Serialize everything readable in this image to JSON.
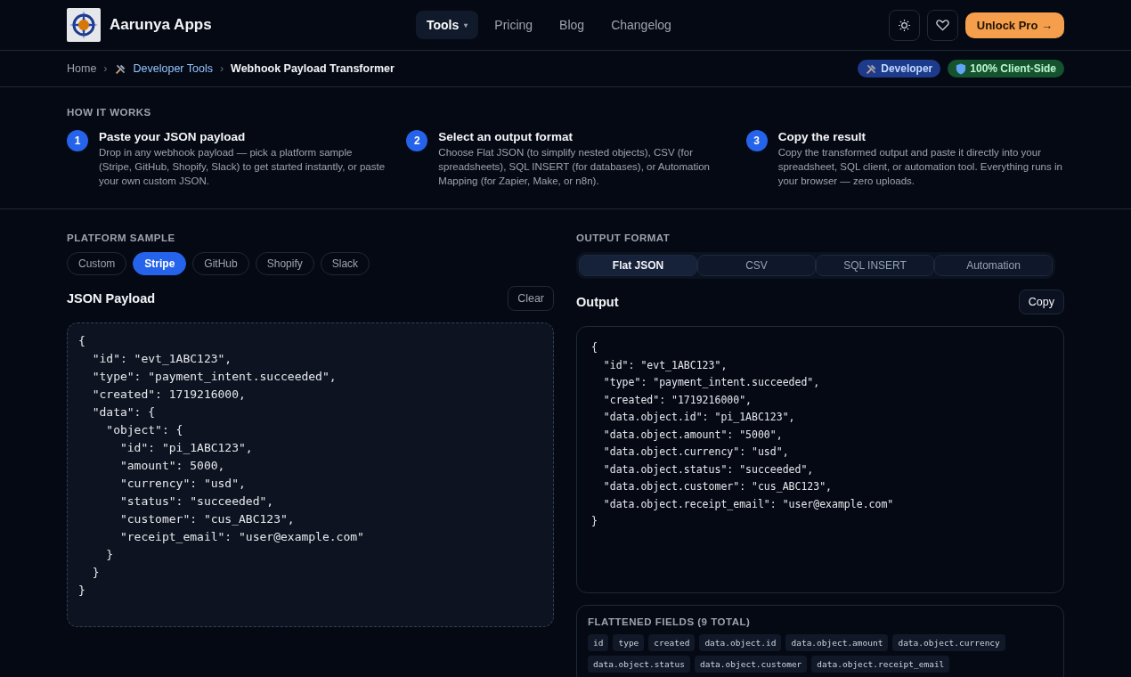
{
  "brand": {
    "name": "Aarunya Apps"
  },
  "nav": [
    {
      "label": "Tools",
      "selected": true,
      "caret": "▾"
    },
    {
      "label": "Pricing",
      "selected": false
    },
    {
      "label": "Blog",
      "selected": false
    },
    {
      "label": "Changelog",
      "selected": false
    }
  ],
  "cta": "Unlock Pro →",
  "breadcrumb": {
    "items": [
      "Home",
      "Developer Tools",
      "Webhook Payload Transformer"
    ],
    "separator": "›"
  },
  "badges": [
    {
      "label": "Developer",
      "color": "#1e3a8a"
    },
    {
      "label": "100% Client-Side",
      "color": "#14532d"
    }
  ],
  "how_it_works": {
    "title": "HOW IT WORKS",
    "steps": [
      {
        "number": "1",
        "title": "Paste your JSON payload",
        "text": "Drop in any webhook payload — pick a platform sample (Stripe, GitHub, Shopify, Slack) to get started instantly, or paste your own custom JSON."
      },
      {
        "number": "2",
        "title": "Select an output format",
        "text": "Choose Flat JSON (to simplify nested objects), CSV (for spreadsheets), SQL INSERT (for databases), or Automation Mapping (for Zapier, Make, or n8n)."
      },
      {
        "number": "3",
        "title": "Copy the result",
        "text": "Copy the transformed output and paste it directly into your spreadsheet, SQL client, or automation tool. Everything runs in your browser — zero uploads."
      }
    ]
  },
  "platform_sample": {
    "title": "PLATFORM SAMPLE",
    "options": [
      {
        "label": "Custom",
        "selected": false
      },
      {
        "label": "Stripe",
        "selected": true
      },
      {
        "label": "GitHub",
        "selected": false
      },
      {
        "label": "Shopify",
        "selected": false
      },
      {
        "label": "Slack",
        "selected": false
      }
    ]
  },
  "input": {
    "title": "JSON Payload",
    "button": "Clear",
    "lines": [
      "{",
      "  \"id\": \"evt_1ABC123\",",
      "  \"type\": \"payment_intent.succeeded\",",
      "  \"created\": 1719216000,",
      "  \"data\": {",
      "    \"object\": {",
      "      \"id\": \"pi_1ABC123\",",
      "      \"amount\": 5000,",
      "      \"currency\": \"usd\",",
      "      \"status\": \"succeeded\",",
      "      \"customer\": \"cus_ABC123\",",
      "      \"receipt_email\": \"user@example.com\"",
      "    }",
      "  }",
      "}"
    ]
  },
  "output_format": {
    "title": "OUTPUT FORMAT",
    "tabs": [
      {
        "label": "Flat JSON",
        "selected": true
      },
      {
        "label": "CSV",
        "selected": false
      },
      {
        "label": "SQL INSERT",
        "selected": false
      },
      {
        "label": "Automation",
        "selected": false
      }
    ]
  },
  "output": {
    "title": "Output",
    "button": "Copy",
    "lines": [
      "{",
      "  \"id\": \"evt_1ABC123\",",
      "  \"type\": \"payment_intent.succeeded\",",
      "  \"created\": \"1719216000\",",
      "  \"data.object.id\": \"pi_1ABC123\",",
      "  \"data.object.amount\": \"5000\",",
      "  \"data.object.currency\": \"usd\",",
      "  \"data.object.status\": \"succeeded\",",
      "  \"data.object.customer\": \"cus_ABC123\",",
      "  \"data.object.receipt_email\": \"user@example.com\"",
      "}"
    ]
  },
  "fields": {
    "title": "FLATTENED FIELDS (9 TOTAL)",
    "items": [
      "id",
      "type",
      "created",
      "data.object.id",
      "data.object.amount",
      "data.object.currency",
      "data.object.status",
      "data.object.customer",
      "data.object.receipt_email"
    ]
  }
}
